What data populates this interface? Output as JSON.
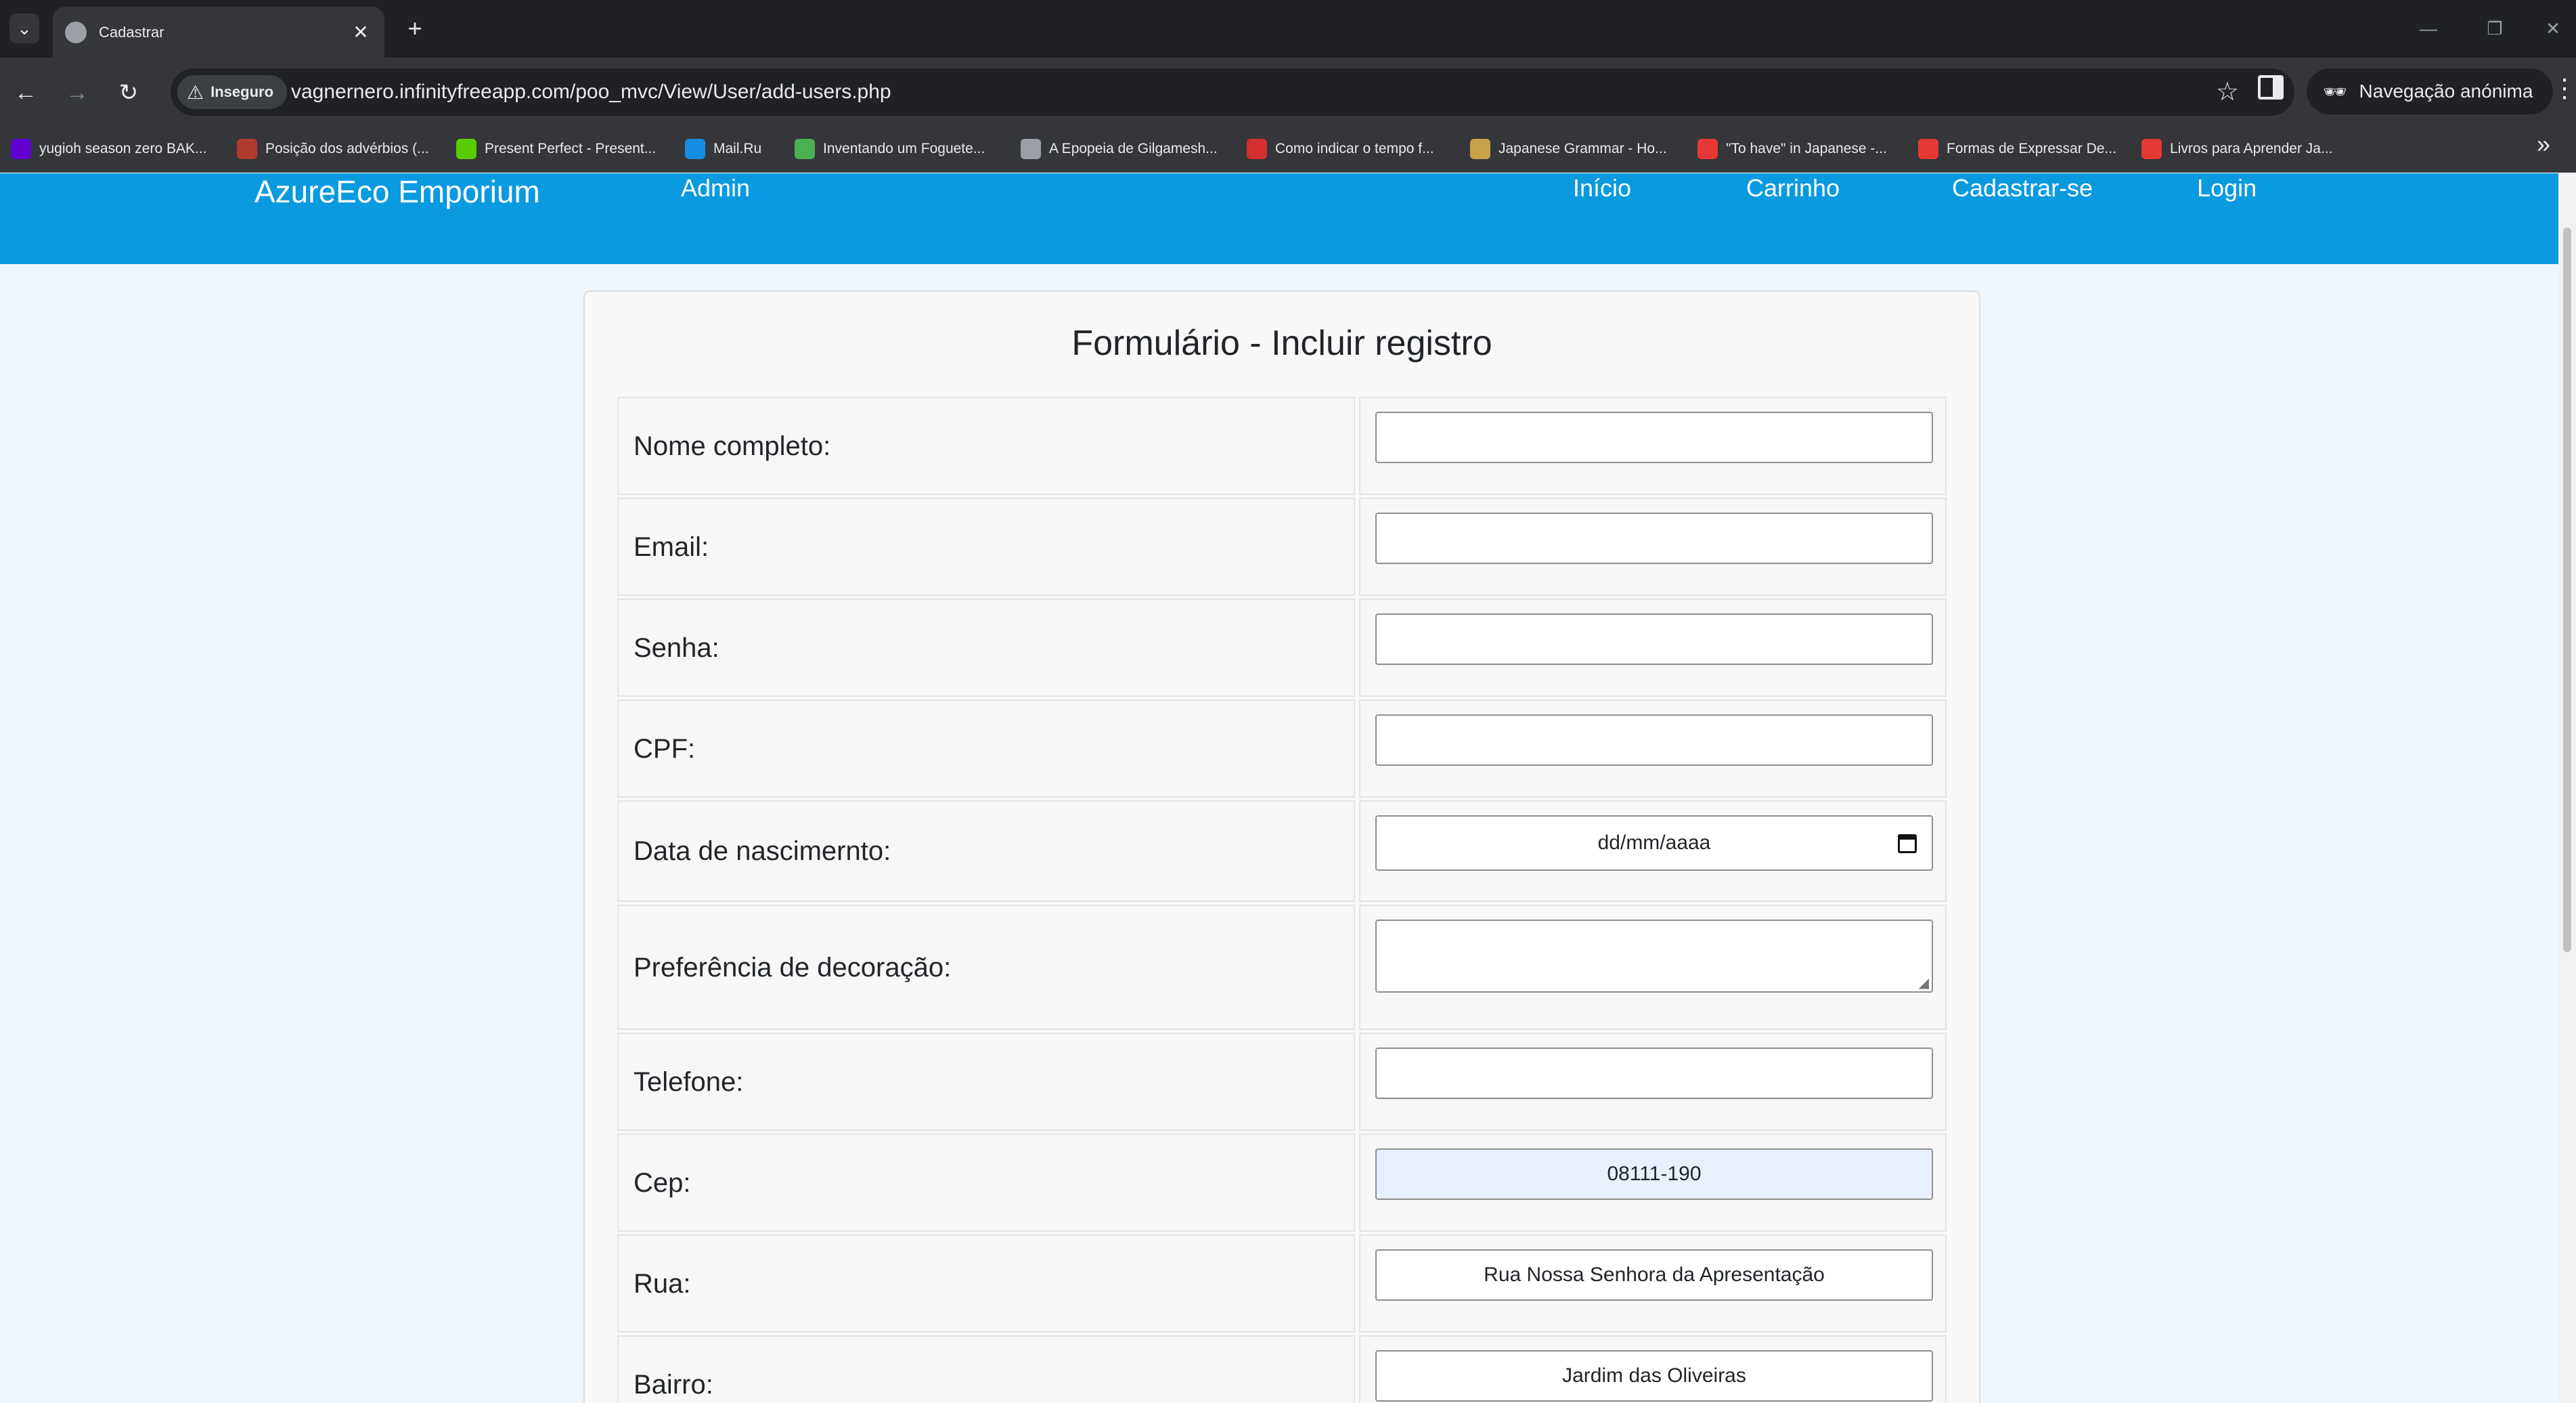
{
  "browser": {
    "tab_title": "Cadastrar",
    "security_label": "Inseguro",
    "url": "vagnernero.infinityfreeapp.com/poo_mvc/View/User/add-users.php",
    "incognito_label": "Navegação anónima",
    "bookmarks": [
      {
        "label": "yugioh season zero BAK...",
        "color": "#6001d2"
      },
      {
        "label": "Posição dos advérbios (...",
        "color": "#b03a2e"
      },
      {
        "label": "Present Perfect - Present...",
        "color": "#58cc02"
      },
      {
        "label": "Mail.Ru",
        "color": "#168de2"
      },
      {
        "label": "Inventando um Foguete...",
        "color": "#4caf50"
      },
      {
        "label": "A Epopeia de Gilgamesh...",
        "color": "#9aa0a6"
      },
      {
        "label": "Como indicar o tempo f...",
        "color": "#d32f2f"
      },
      {
        "label": "Japanese Grammar - Ho...",
        "color": "#c8a24a"
      },
      {
        "label": "\"To have\" in Japanese -...",
        "color": "#e53935"
      },
      {
        "label": "Formas de Expressar De...",
        "color": "#e53935"
      },
      {
        "label": "Livros para Aprender Ja...",
        "color": "#e53935"
      }
    ]
  },
  "site": {
    "brand": "AzureEco Emporium",
    "nav": {
      "admin": "Admin",
      "inicio": "Início",
      "carrinho": "Carrinho",
      "cadastrar": "Cadastrar-se",
      "login": "Login"
    },
    "accent_color": "#0a9ae0"
  },
  "form": {
    "title": "Formulário - Incluir registro",
    "fields": {
      "nome": {
        "label": "Nome completo:",
        "value": ""
      },
      "email": {
        "label": "Email:",
        "value": ""
      },
      "senha": {
        "label": "Senha:",
        "value": ""
      },
      "cpf": {
        "label": "CPF:",
        "value": ""
      },
      "nascimento": {
        "label": "Data de nascimernto:",
        "placeholder": "dd/mm/aaaa"
      },
      "decoracao": {
        "label": "Preferência de decoração:",
        "value": ""
      },
      "telefone": {
        "label": "Telefone:",
        "value": ""
      },
      "cep": {
        "label": "Cep:",
        "value": "08111-190"
      },
      "rua": {
        "label": "Rua:",
        "value": "Rua Nossa Senhora da Apresentação"
      },
      "bairro": {
        "label": "Bairro:",
        "value": "Jardim das Oliveiras"
      }
    }
  }
}
